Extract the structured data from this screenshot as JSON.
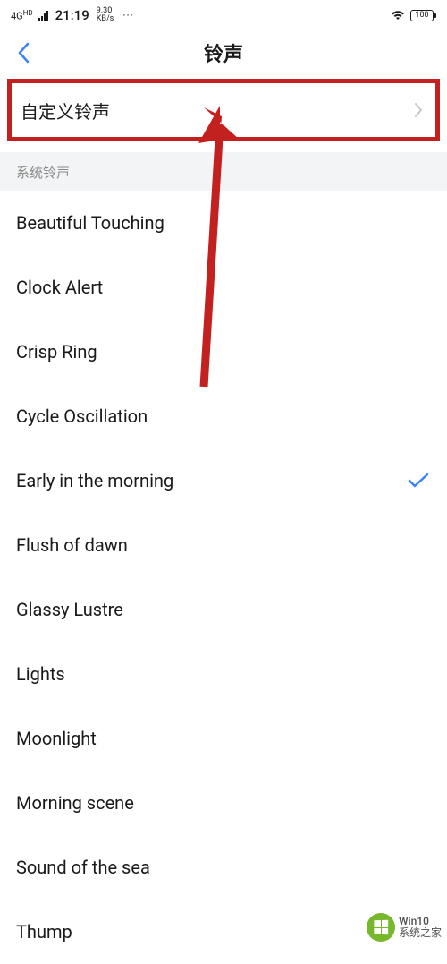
{
  "status_bar": {
    "network_type": "4G",
    "network_hd": "HD",
    "time": "21:19",
    "speed_value": "9.30",
    "speed_unit": "KB/s",
    "dots": "···",
    "battery_level": "100"
  },
  "header": {
    "title": "铃声"
  },
  "custom_ringtone": {
    "label": "自定义铃声"
  },
  "section": {
    "title": "系统铃声"
  },
  "ringtones": [
    {
      "label": "Beautiful Touching",
      "selected": false
    },
    {
      "label": "Clock Alert",
      "selected": false
    },
    {
      "label": "Crisp Ring",
      "selected": false
    },
    {
      "label": "Cycle Oscillation",
      "selected": false
    },
    {
      "label": "Early in the morning",
      "selected": true
    },
    {
      "label": "Flush of dawn",
      "selected": false
    },
    {
      "label": "Glassy Lustre",
      "selected": false
    },
    {
      "label": "Lights",
      "selected": false
    },
    {
      "label": "Moonlight",
      "selected": false
    },
    {
      "label": "Morning scene",
      "selected": false
    },
    {
      "label": "Sound of the sea",
      "selected": false
    },
    {
      "label": "Thump",
      "selected": false
    }
  ],
  "watermark": {
    "line1": "Win10",
    "line2": "系统之家"
  },
  "annotation": {
    "arrow_color": "#c32020"
  }
}
